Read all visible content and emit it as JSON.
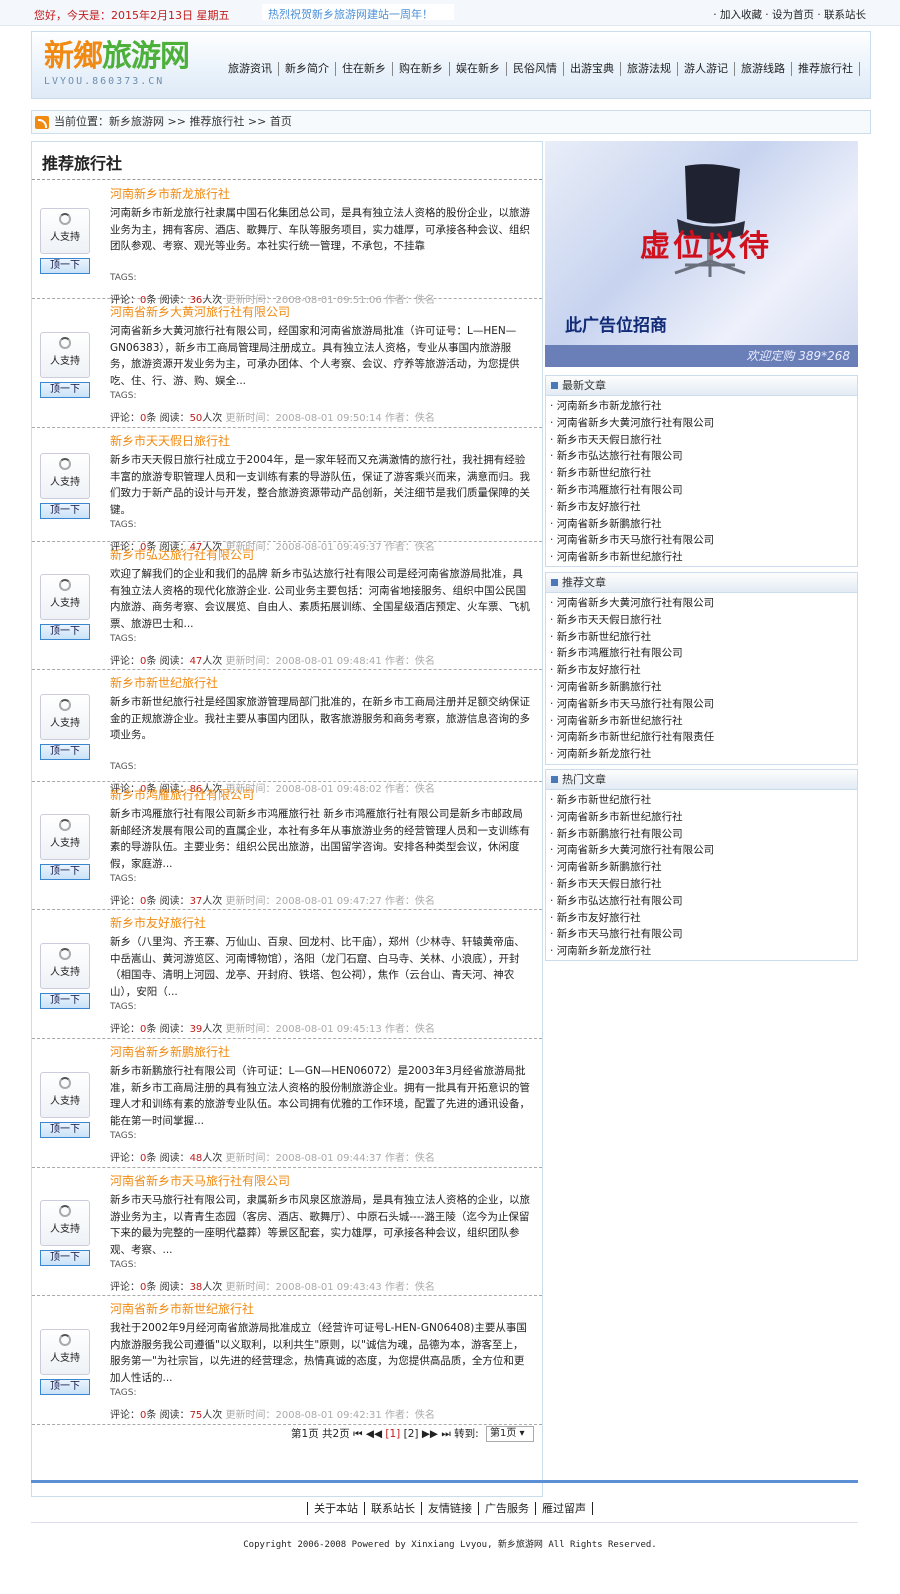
{
  "topbar": {
    "date": "您好，今天是：2015年2月13日 星期五",
    "marquee": "热烈祝贺新乡旅游网建站一周年！",
    "quick": "· 加入收藏 · 设为首页 · 联系站长"
  },
  "logo": {
    "part1": "新鄉",
    "part2": "旅游网",
    "domain": "LVYOU.860373.CN"
  },
  "nav": [
    "旅游资讯",
    "新乡简介",
    "住在新乡",
    "购在新乡",
    "娱在新乡",
    "民俗风情",
    "出游宝典",
    "旅游法规",
    "游人游记",
    "旅游线路",
    "推荐旅行社"
  ],
  "crumb": {
    "prefix": "当前位置：",
    "links": [
      "新乡旅游网",
      "推荐旅行社",
      "首页"
    ],
    "sep": " >> "
  },
  "main": {
    "title": "推荐旅行社"
  },
  "vote": {
    "label": "人支持",
    "button": "顶一下"
  },
  "labels": {
    "tags": "TAGS:",
    "comment": "评论：",
    "comment_unit": "条",
    "read": "阅读：",
    "read_unit": "人次",
    "updated": "更新时间：",
    "author": "作者：",
    "author_name": "佚名"
  },
  "items": [
    {
      "title": "河南新乡市新龙旅行社",
      "desc": "河南新乡市新龙旅行社隶属中国石化集团总公司，是具有独立法人资格的股份企业，以旅游业务为主，拥有客房、酒店、歌舞厅、车队等服务项目，实力雄厚，可承接各种会议、组织团队参观、考察、观光等业务。本社实行统一管理，不承包，不挂靠",
      "comments": "0",
      "reads": "36",
      "time": "2008-08-01 09:51:06"
    },
    {
      "title": "河南省新乡大黄河旅行社有限公司",
      "desc": "河南省新乡大黄河旅行社有限公司，经国家和河南省旅游局批准（许可证号：L—HEN—GN06383），新乡市工商局管理局注册成立。具有独立法人资格，专业从事国内旅游服务，旅游资源开发业务为主，可承办团体、个人考察、会议、疗养等旅游活动，为您提供吃、住、行、游、购、娱全...",
      "comments": "0",
      "reads": "50",
      "time": "2008-08-01 09:50:14"
    },
    {
      "title": "新乡市天天假日旅行社",
      "desc": "新乡市天天假日旅行社成立于2004年，是一家年轻而又充满激情的旅行社，我社拥有经验丰富的旅游专职管理人员和一支训练有素的导游队伍，保证了游客乘兴而来，满意而归。我们致力于新产品的设计与开发，整合旅游资源带动产品创新，关注细节是我们质量保障的关键。",
      "comments": "0",
      "reads": "47",
      "time": "2008-08-01 09:49:37"
    },
    {
      "title": "新乡市弘达旅行社有限公司",
      "desc": "欢迎了解我们的企业和我们的品牌 新乡市弘达旅行社有限公司是经河南省旅游局批准，具有独立法人资格的现代化旅游企业. 公司业务主要包括：河南省地接服务、组织中国公民国内旅游、商务考察、会议展览、自由人、素质拓展训练、全国星级酒店预定、火车票、飞机票、旅游巴士和...",
      "comments": "0",
      "reads": "47",
      "time": "2008-08-01 09:48:41"
    },
    {
      "title": "新乡市新世纪旅行社",
      "desc": "新乡市新世纪旅行社是经国家旅游管理局部门批准的，在新乡市工商局注册并足额交纳保证金的正规旅游企业。我社主要从事国内团队，散客旅游服务和商务考察，旅游信息咨询的多项业务。",
      "comments": "0",
      "reads": "86",
      "time": "2008-08-01 09:48:02"
    },
    {
      "title": "新乡市鸿雁旅行社有限公司",
      "desc": "新乡市鸿雁旅行社有限公司新乡市鸿雁旅行社 新乡市鸿雁旅行社有限公司是新乡市邮政局新邮经济发展有限公司的直属企业，本社有多年从事旅游业务的经营管理人员和一支训练有素的导游队伍。主要业务：组织公民出旅游，出国留学咨询。安排各种类型会议，休闲度假，家庭游...",
      "comments": "0",
      "reads": "37",
      "time": "2008-08-01 09:47:27"
    },
    {
      "title": "新乡市友好旅行社",
      "desc": "新乡（八里沟、齐王寨、万仙山、百泉、回龙村、比干庙），郑州（少林寺、轩辕黄帝庙、中岳嵩山、黄河游览区、河南博物馆），洛阳（龙门石窟、白马寺、关林、小浪底），开封（相国寺、清明上河园、龙亭、开封府、铁塔、包公祠），焦作（云台山、青天河、神农山），安阳（...",
      "comments": "0",
      "reads": "39",
      "time": "2008-08-01 09:45:13"
    },
    {
      "title": "河南省新乡新鹏旅行社",
      "desc": "新乡市新鹏旅行社有限公司（许可证：L—GN—HEN06072）是2003年3月经省旅游局批准，新乡市工商局注册的具有独立法人资格的股份制旅游企业。拥有一批具有开拓意识的管理人才和训练有素的旅游专业队伍。本公司拥有优雅的工作环境，配置了先进的通讯设备，能在第一时间掌握...",
      "comments": "0",
      "reads": "48",
      "time": "2008-08-01 09:44:37"
    },
    {
      "title": "河南省新乡市天马旅行社有限公司",
      "desc": "新乡市天马旅行社有限公司，隶属新乡市风泉区旅游局，是具有独立法人资格的企业，以旅游业务为主，以青青生态园（客房、酒店、歌舞厅）、中原石头城----潞王陵（迄今为止保留下来的最为完整的一座明代墓葬）等景区配套，实力雄厚，可承接各种会议，组织团队参观、考察、...",
      "comments": "0",
      "reads": "38",
      "time": "2008-08-01 09:43:43"
    },
    {
      "title": "河南省新乡市新世纪旅行社",
      "desc": "我社于2002年9月经河南省旅游局批准成立（经营许可证号L-HEN-GN06408)主要从事国内旅游服务我公司遵循\"以义取利，以利共生\"原则，以\"诚信为魂，品德为本，游客至上，服务第一\"为社宗旨，以先进的经营理念，热情真诚的态度，为您提供高品质，全方位和更加人性话的...",
      "comments": "0",
      "reads": "75",
      "time": "2008-08-01 09:42:31"
    }
  ],
  "pager": {
    "text1": "第1页 共2页",
    "first": "⏮",
    "prev": "◀◀",
    "p1": "[1]",
    "p2": "[2]",
    "next": "▶▶",
    "last": "⏭",
    "jump": "转到:",
    "select": "第1页"
  },
  "ad": {
    "big": "虚位以待",
    "sub": "此广告位招商",
    "strip": "欢迎定购  389*268"
  },
  "latest": {
    "title": "最新文章",
    "items": [
      "河南新乡市新龙旅行社",
      "河南省新乡大黄河旅行社有限公司",
      "新乡市天天假日旅行社",
      "新乡市弘达旅行社有限公司",
      "新乡市新世纪旅行社",
      "新乡市鸿雁旅行社有限公司",
      "新乡市友好旅行社",
      "河南省新乡新鹏旅行社",
      "河南省新乡市天马旅行社有限公司",
      "河南省新乡市新世纪旅行社"
    ]
  },
  "recommend": {
    "title": "推荐文章",
    "items": [
      "河南省新乡大黄河旅行社有限公司",
      "新乡市天天假日旅行社",
      "新乡市新世纪旅行社",
      "新乡市鸿雁旅行社有限公司",
      "新乡市友好旅行社",
      "河南省新乡新鹏旅行社",
      "河南省新乡市天马旅行社有限公司",
      "河南省新乡市新世纪旅行社",
      "河南新乡市新世纪旅行社有限责任",
      "河南新乡新龙旅行社"
    ]
  },
  "hot": {
    "title": "热门文章",
    "items": [
      "新乡市新世纪旅行社",
      "河南省新乡市新世纪旅行社",
      "新乡市新鹏旅行社有限公司",
      "河南省新乡大黄河旅行社有限公司",
      "河南省新乡新鹏旅行社",
      "新乡市天天假日旅行社",
      "新乡市弘达旅行社有限公司",
      "新乡市友好旅行社",
      "新乡市天马旅行社有限公司",
      "河南新乡新龙旅行社"
    ]
  },
  "footer": {
    "links": [
      "关于本站",
      "联系站长",
      "友情链接",
      "广告服务",
      "雁过留声"
    ],
    "copyright": "Copyright 2006-2008 Powered by Xinxiang Lvyou, 新乡旅游网 All Rights Reserved."
  }
}
